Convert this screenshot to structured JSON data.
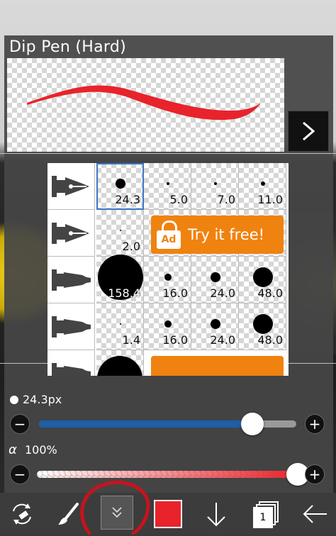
{
  "brush": {
    "name": "Dip Pen (Hard)",
    "color": "#e8232b",
    "next_icon": "chevron-right-icon"
  },
  "grid": {
    "rows": [
      {
        "pen": "dip-pen-icon",
        "sizes": [
          "24.3",
          "5.0",
          "7.0",
          "11.0"
        ],
        "selected_index": 0
      },
      {
        "pen": "dip-pen-icon",
        "sizes": [
          "2.0"
        ],
        "ad": "Try it free!"
      },
      {
        "pen": "marker-pen-icon",
        "sizes": [
          "158.4",
          "16.0",
          "24.0",
          "48.0"
        ]
      },
      {
        "pen": "marker-pen-icon",
        "sizes": [
          "1.4",
          "16.0",
          "24.0",
          "48.0"
        ]
      }
    ],
    "ad_badge": "Ad",
    "selection_color": "#3a78c8"
  },
  "size_slider": {
    "label": "24.3px",
    "value_fraction": 0.83,
    "minus": "−",
    "plus": "+",
    "track_color": "#1f5ea8"
  },
  "opacity_slider": {
    "symbol": "α",
    "label": "100%",
    "value_fraction": 1.0,
    "minus": "−",
    "plus": "+"
  },
  "toolbar": {
    "items": [
      "swap-tools-icon",
      "brush-icon",
      "collapse-icon",
      "color-swatch",
      "move-down-icon",
      "layers-icon",
      "back-icon"
    ],
    "layer_count": "1",
    "color": "#e8232b",
    "annotation_color": "#c5141c"
  }
}
